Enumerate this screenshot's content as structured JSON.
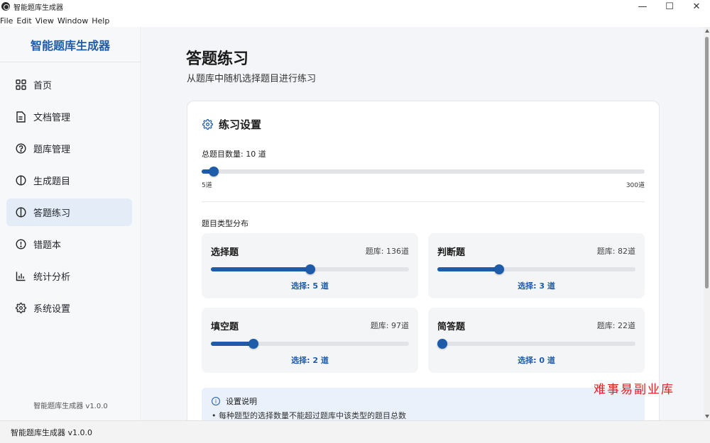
{
  "window": {
    "title": "智能题库生成器",
    "minimize": "—",
    "maximize": "☐",
    "close": "✕"
  },
  "menu": [
    "File",
    "Edit",
    "View",
    "Window",
    "Help"
  ],
  "sidebar": {
    "brand": "智能题库生成器",
    "items": [
      {
        "label": "首页",
        "icon": "grid-icon"
      },
      {
        "label": "文档管理",
        "icon": "document-icon"
      },
      {
        "label": "题库管理",
        "icon": "question-circle-icon"
      },
      {
        "label": "生成题目",
        "icon": "bulb-icon"
      },
      {
        "label": "答题练习",
        "icon": "bulb-icon",
        "active": true
      },
      {
        "label": "错题本",
        "icon": "alert-circle-icon"
      },
      {
        "label": "统计分析",
        "icon": "bar-chart-icon"
      },
      {
        "label": "系统设置",
        "icon": "gear-icon"
      }
    ],
    "version": "智能题库生成器 v1.0.0"
  },
  "main": {
    "title": "答题练习",
    "subtitle": "从题库中随机选择题目进行练习",
    "settings": {
      "title": "练习设置",
      "total_label": "总题目数量: 10 道",
      "total_value": 10,
      "total_min": 5,
      "total_max": 300,
      "min_label": "5道",
      "max_label": "300道",
      "distribution_label": "题目类型分布",
      "types": [
        {
          "name": "选择题",
          "bank": "题库: 136道",
          "select": "选择: 5 道",
          "value": 5,
          "max": 136
        },
        {
          "name": "判断题",
          "bank": "题库: 82道",
          "select": "选择: 3 道",
          "value": 3,
          "max": 82
        },
        {
          "name": "填空题",
          "bank": "题库: 97道",
          "select": "选择: 2 道",
          "value": 2,
          "max": 97
        },
        {
          "name": "简答题",
          "bank": "题库: 22道",
          "select": "选择: 0 道",
          "value": 0,
          "max": 22
        }
      ],
      "info_title": "设置说明",
      "info_line": "• 每种题型的选择数量不能超过题库中该类型的题目总数"
    }
  },
  "watermark": "难事易副业库",
  "status": "智能题库生成器 v1.0.0",
  "colors": {
    "accent": "#1e5ba8",
    "active_bg": "#e4ecf7",
    "watermark": "#e02020"
  }
}
